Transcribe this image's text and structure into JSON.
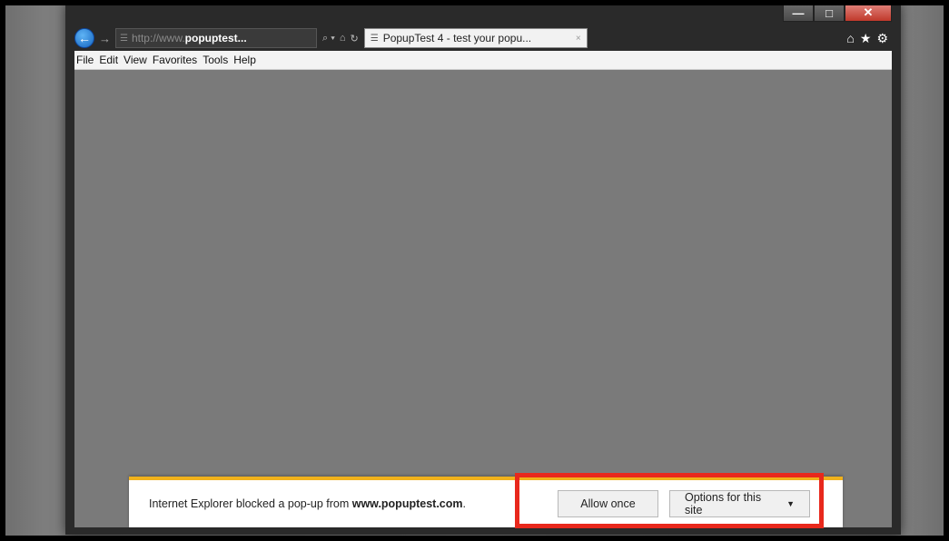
{
  "window": {
    "controls": {
      "minimize": "—",
      "maximize": "□",
      "close": "✕"
    }
  },
  "nav": {
    "back_icon": "arrow-left-icon",
    "forward_icon": "arrow-right-icon",
    "back_glyph": "←",
    "forward_glyph": "→"
  },
  "address": {
    "url_prefix": "http://www.",
    "url_domain": "popuptest...",
    "search_glyph": "⌕ ▾",
    "compat_glyph": "⌂",
    "refresh_glyph": "↻"
  },
  "tab": {
    "title": "PopupTest 4 - test your popu...",
    "close_glyph": "×"
  },
  "toolbar_icons": {
    "home": "⌂",
    "favorites": "★",
    "settings": "⚙"
  },
  "menu": [
    "File",
    "Edit",
    "View",
    "Favorites",
    "Tools",
    "Help"
  ],
  "notification": {
    "message_prefix": "Internet Explorer blocked a pop-up from ",
    "message_domain": "www.popuptest.com",
    "message_suffix": ".",
    "allow_label": "Allow once",
    "options_label": "Options for this site",
    "options_caret": "▼",
    "accent_color": "#f1b21c"
  },
  "highlight": {
    "color": "#e8281c"
  }
}
